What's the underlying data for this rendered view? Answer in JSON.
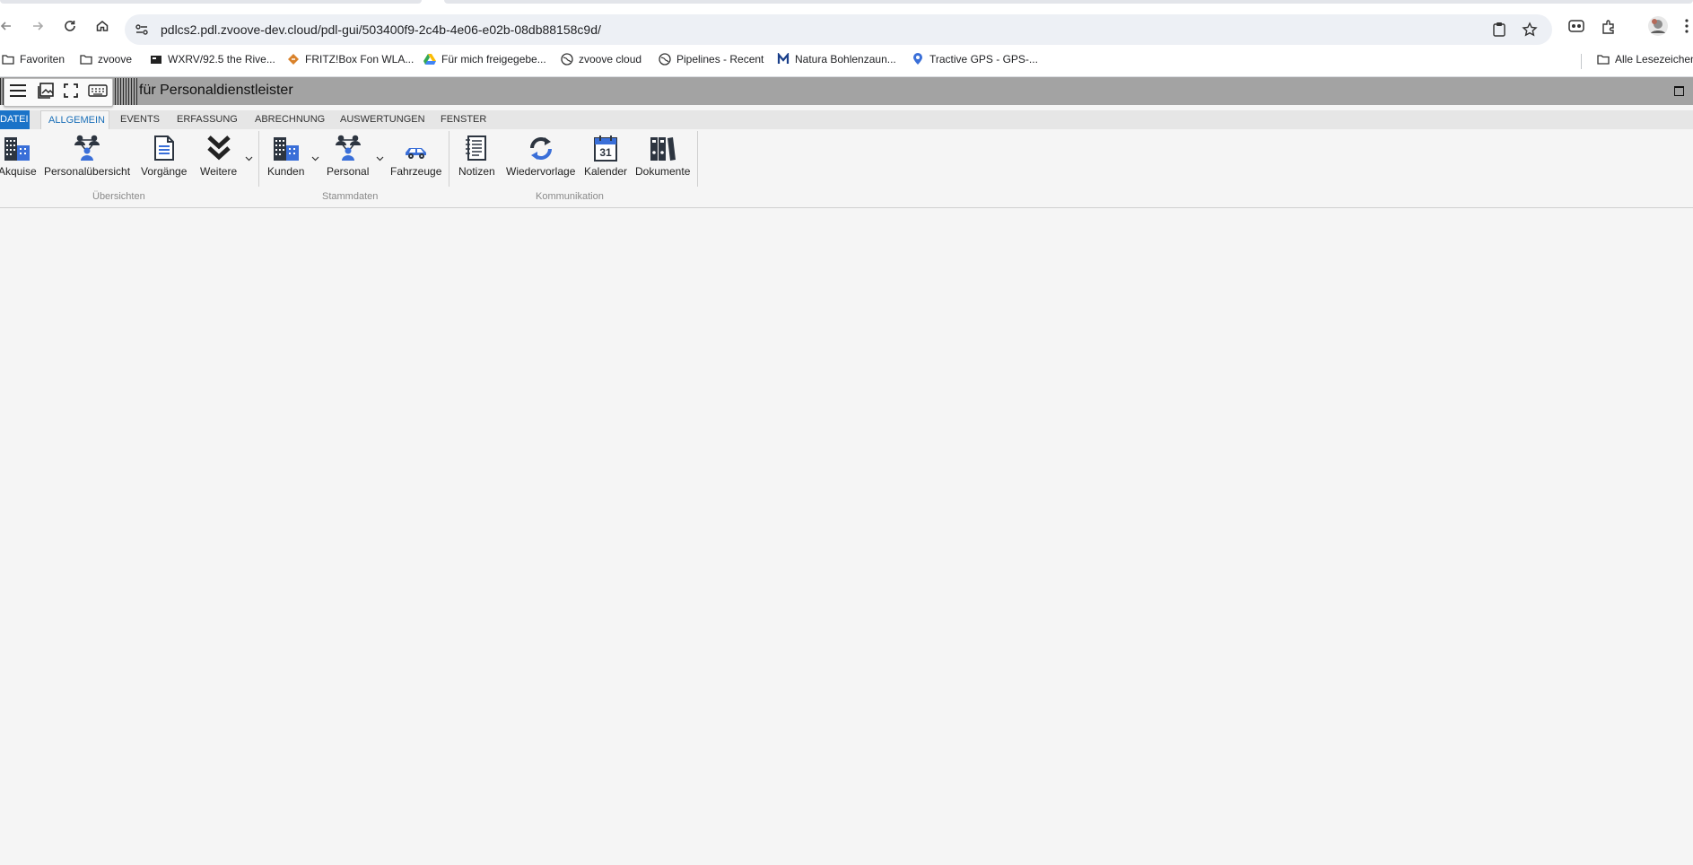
{
  "browser": {
    "url": "pdlcs2.pdl.zvoove-dev.cloud/pdl-gui/503400f9-2c4b-4e06-e02b-08db88158c9d/",
    "bookmarks": [
      {
        "label": "Favoriten",
        "icon": "folder-icon"
      },
      {
        "label": "zvoove",
        "icon": "folder-icon"
      },
      {
        "label": "WXRV/92.5 the Rive...",
        "icon": "radio-icon"
      },
      {
        "label": "FRITZ!Box Fon WLA...",
        "icon": "fritz-icon"
      },
      {
        "label": "Für mich freigegebe...",
        "icon": "drive-icon"
      },
      {
        "label": "zvoove cloud",
        "icon": "globe-icon"
      },
      {
        "label": "Pipelines - Recent",
        "icon": "globe-icon"
      },
      {
        "label": "Natura Bohlenzaun...",
        "icon": "m-icon"
      },
      {
        "label": "Tractive GPS - GPS-...",
        "icon": "pin-icon"
      }
    ],
    "all_bookmarks": "Alle Lesezeichen"
  },
  "app": {
    "title": "für Personaldienstleister"
  },
  "menu": {
    "tabs": [
      "DATEI",
      "ALLGEMEIN",
      "EVENTS",
      "ERFASSUNG",
      "ABRECHNUNG",
      "AUSWERTUNGEN",
      "FENSTER"
    ],
    "active": "ALLGEMEIN"
  },
  "ribbon": {
    "groups": {
      "uebersichten": "Übersichten",
      "stammdaten": "Stammdaten",
      "kommunikation": "Kommunikation"
    },
    "buttons": {
      "akquise": "Akquise",
      "personaluebersicht": "Personalübersicht",
      "vorgaenge": "Vorgänge",
      "weitere": "Weitere",
      "kunden": "Kunden",
      "personal": "Personal",
      "fahrzeuge": "Fahrzeuge",
      "notizen": "Notizen",
      "wiedervorlage": "Wiedervorlage",
      "kalender": "Kalender",
      "kalender_day": "31",
      "dokumente": "Dokumente"
    }
  },
  "colors": {
    "accent": "#1a73c8",
    "title_bar": "#a3a3a3",
    "icon": "#2d3540"
  }
}
